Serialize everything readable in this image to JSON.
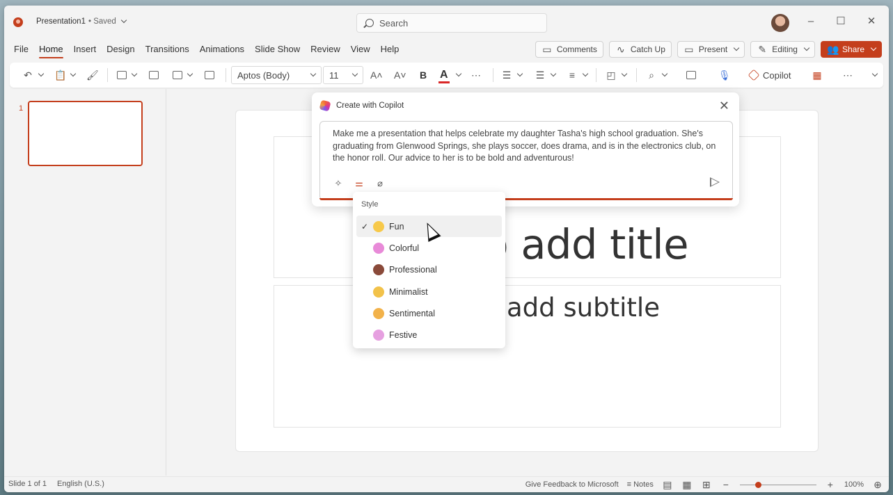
{
  "titlebar": {
    "doc_name": "Presentation1",
    "doc_status": "• Saved",
    "search_placeholder": "Search"
  },
  "tabs": [
    "File",
    "Home",
    "Insert",
    "Design",
    "Transitions",
    "Animations",
    "Slide Show",
    "Review",
    "View",
    "Help"
  ],
  "active_tab": "Home",
  "top_buttons": {
    "comments": "Comments",
    "catch_up": "Catch Up",
    "present": "Present",
    "editing": "Editing",
    "share": "Share"
  },
  "ribbon": {
    "font_name": "Aptos (Body)",
    "font_size": "11",
    "copilot": "Copilot"
  },
  "thumbnails": {
    "slide_number": "1"
  },
  "slide": {
    "title_placeholder": "o add title",
    "subtitle_placeholder": "add subtitle"
  },
  "copilot_panel": {
    "title": "Create with Copilot",
    "prompt": "Make me a presentation that helps celebrate my daughter Tasha's high school graduation. She's graduating from Glenwood Springs, she plays soccer, does drama, and is in the electronics club, on the honor roll. Our advice to her is to be bold and adventurous!"
  },
  "style_menu": {
    "heading": "Style",
    "items": [
      {
        "label": "Fun",
        "selected": true,
        "icon": "grinning-face-icon",
        "color": "#f7c94a"
      },
      {
        "label": "Colorful",
        "selected": false,
        "icon": "lollipop-icon",
        "color": "#e88ad8"
      },
      {
        "label": "Professional",
        "selected": false,
        "icon": "briefcase-icon",
        "color": "#8a4a3a"
      },
      {
        "label": "Minimalist",
        "selected": false,
        "icon": "slight-smile-icon",
        "color": "#f2c24a"
      },
      {
        "label": "Sentimental",
        "selected": false,
        "icon": "hugging-face-icon",
        "color": "#f2b24a"
      },
      {
        "label": "Festive",
        "selected": false,
        "icon": "party-popper-icon",
        "color": "#e6a0e0"
      }
    ]
  },
  "statusbar": {
    "slide_count": "Slide 1 of 1",
    "language": "English (U.S.)",
    "feedback": "Give Feedback to Microsoft",
    "notes": "Notes",
    "zoom": "100%"
  },
  "colors": {
    "accent": "#c43e1c"
  }
}
